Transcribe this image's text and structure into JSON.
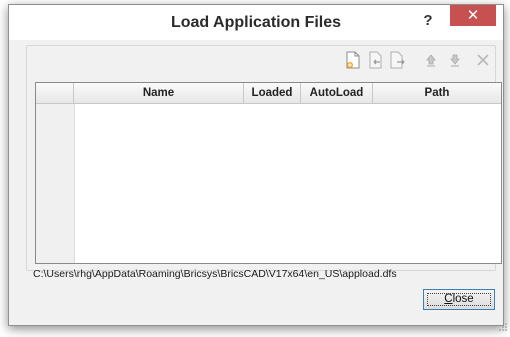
{
  "window": {
    "title": "Load Application Files",
    "help_label": "?",
    "close_glyph": "✕"
  },
  "toolbar": {
    "icons": [
      "new-file-icon",
      "import-icon",
      "export-icon",
      "move-up-icon",
      "move-down-icon",
      "delete-icon"
    ]
  },
  "table": {
    "columns": [
      "Name",
      "Loaded",
      "AutoLoad",
      "Path"
    ],
    "rows": []
  },
  "file_path": "C:\\Users\\rhg\\AppData\\Roaming\\Bricsys\\BricsCAD\\V17x64\\en_US\\appload.dfs",
  "actions": {
    "close_prefix": "",
    "close_mnemonic": "C",
    "close_rest": "lose"
  },
  "colors": {
    "close_button": "#c75050",
    "focus_border": "#3c7fb1"
  }
}
